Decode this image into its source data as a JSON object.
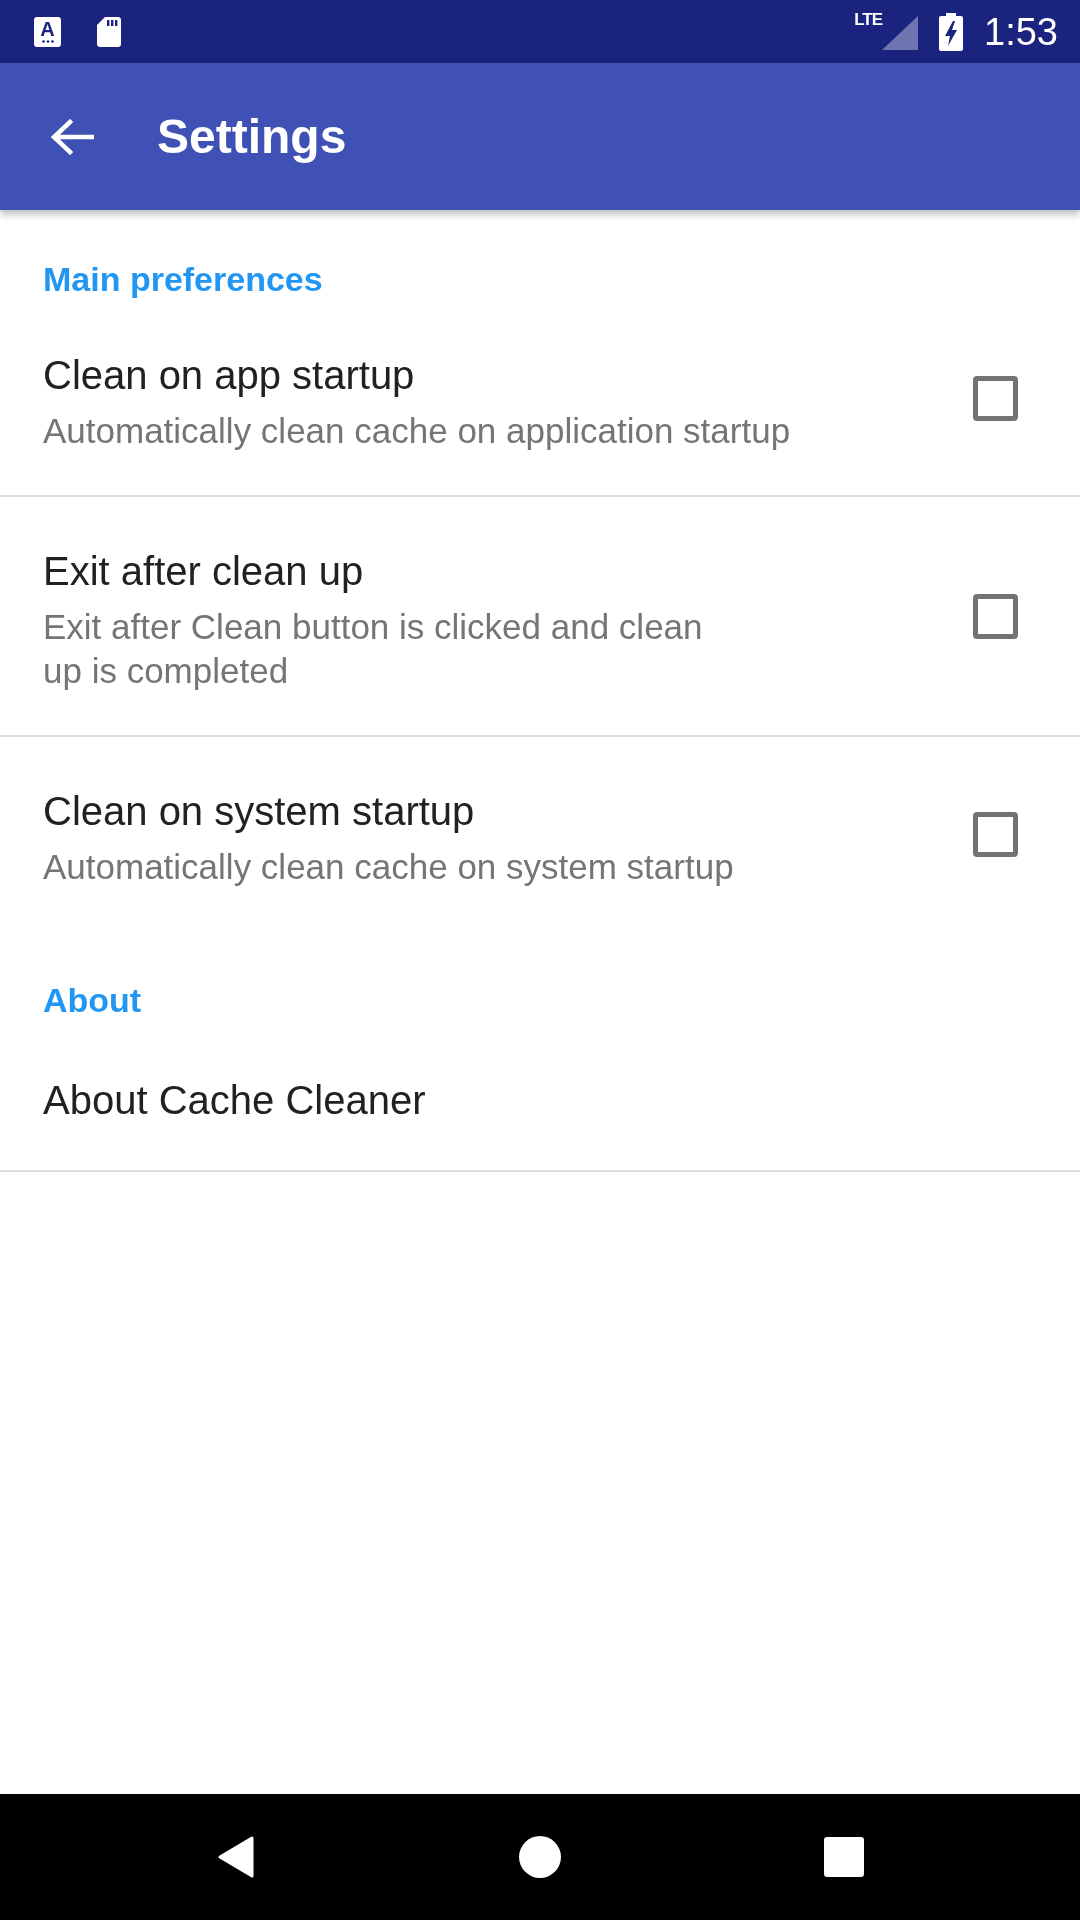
{
  "status_bar": {
    "notifications": [
      {
        "kind": "app",
        "letter": "A"
      },
      {
        "kind": "sd_card"
      }
    ],
    "network": "LTE",
    "time": "1:53"
  },
  "app_bar": {
    "title": "Settings"
  },
  "sections": [
    {
      "title": "Main preferences",
      "items": [
        {
          "kind": "checkbox",
          "title": "Clean on app startup",
          "summary": "Automatically clean cache on application startup",
          "checked": false
        },
        {
          "kind": "checkbox",
          "title": "Exit after clean up",
          "summary": "Exit after Clean button is clicked and clean\nup is completed",
          "checked": false
        },
        {
          "kind": "checkbox",
          "title": "Clean on system startup",
          "summary": "Automatically clean cache on system startup",
          "checked": false
        }
      ]
    },
    {
      "title": "About",
      "items": [
        {
          "kind": "plain",
          "title": "About Cache Cleaner"
        }
      ]
    }
  ]
}
